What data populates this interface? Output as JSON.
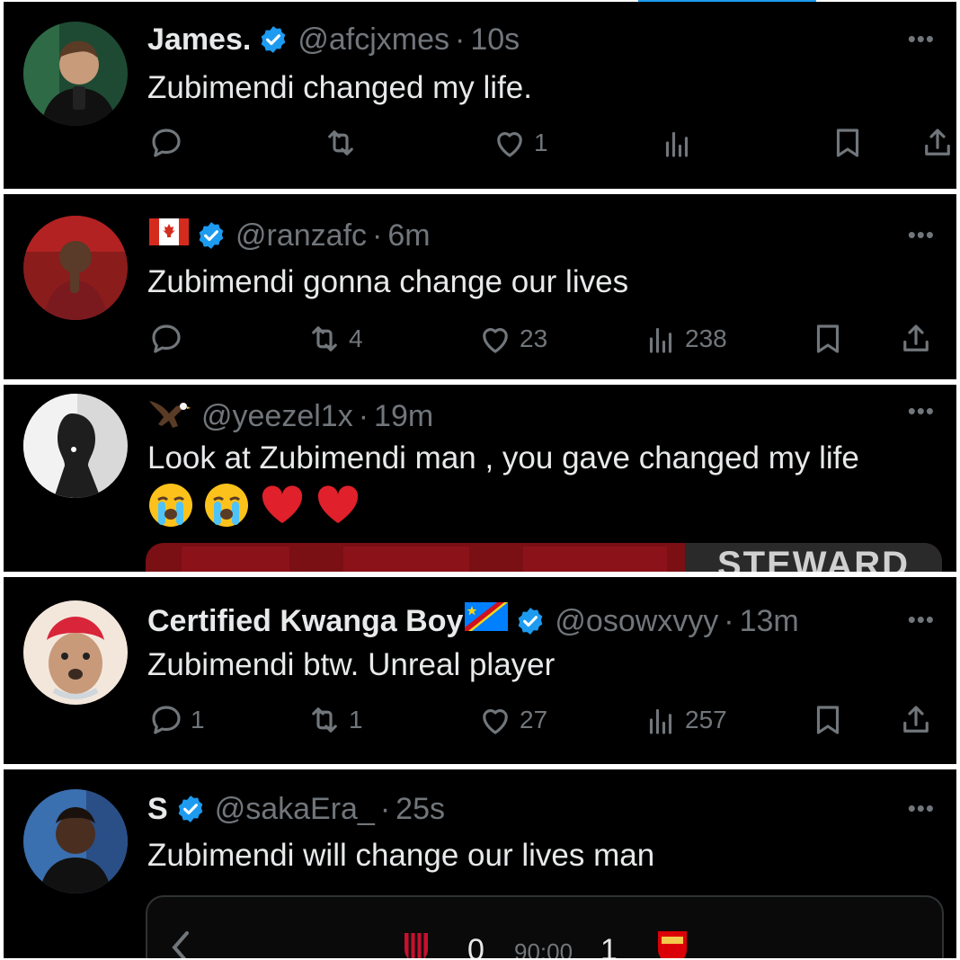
{
  "colors": {
    "background": "#000000",
    "text": "#e7e9ea",
    "muted": "#71767b",
    "verified": "#1d9bf0",
    "accent_bar": "#1d9bf0"
  },
  "tweets": [
    {
      "name": "James.",
      "verified": true,
      "handle": "@afcjxmes",
      "time": "10s",
      "text": "Zubimendi changed my life.",
      "replies": "",
      "retweets": "",
      "likes": "1",
      "views": ""
    },
    {
      "name": "",
      "flag": "canada-flag",
      "verified": true,
      "handle": "@ranzafc",
      "time": "6m",
      "text": "Zubimendi gonna change our lives",
      "replies": "",
      "retweets": "4",
      "likes": "23",
      "views": "238"
    },
    {
      "name": "",
      "name_icon": "eagle-icon",
      "verified": false,
      "handle": "@yeezel1x",
      "time": "19m",
      "text": "Look at Zubimendi man , you gave changed my life",
      "emojis": [
        "loudly-crying-face",
        "loudly-crying-face",
        "red-heart",
        "red-heart"
      ],
      "media_text": "STEWARD"
    },
    {
      "name": "Certified Kwanga Boy",
      "flag": "dr-congo-flag",
      "verified": true,
      "handle": "@osowxvyy",
      "time": "13m",
      "text": "Zubimendi btw. Unreal player",
      "replies": "1",
      "retweets": "1",
      "likes": "27",
      "views": "257"
    },
    {
      "name": "S",
      "verified": true,
      "handle": "@sakaEra_",
      "time": "25s",
      "text": "Zubimendi will change our lives man",
      "score_card": {
        "home_score": "0",
        "clock": "90:00",
        "away_score": "1"
      }
    }
  ],
  "dot_separator": "·",
  "more_label": "•••"
}
